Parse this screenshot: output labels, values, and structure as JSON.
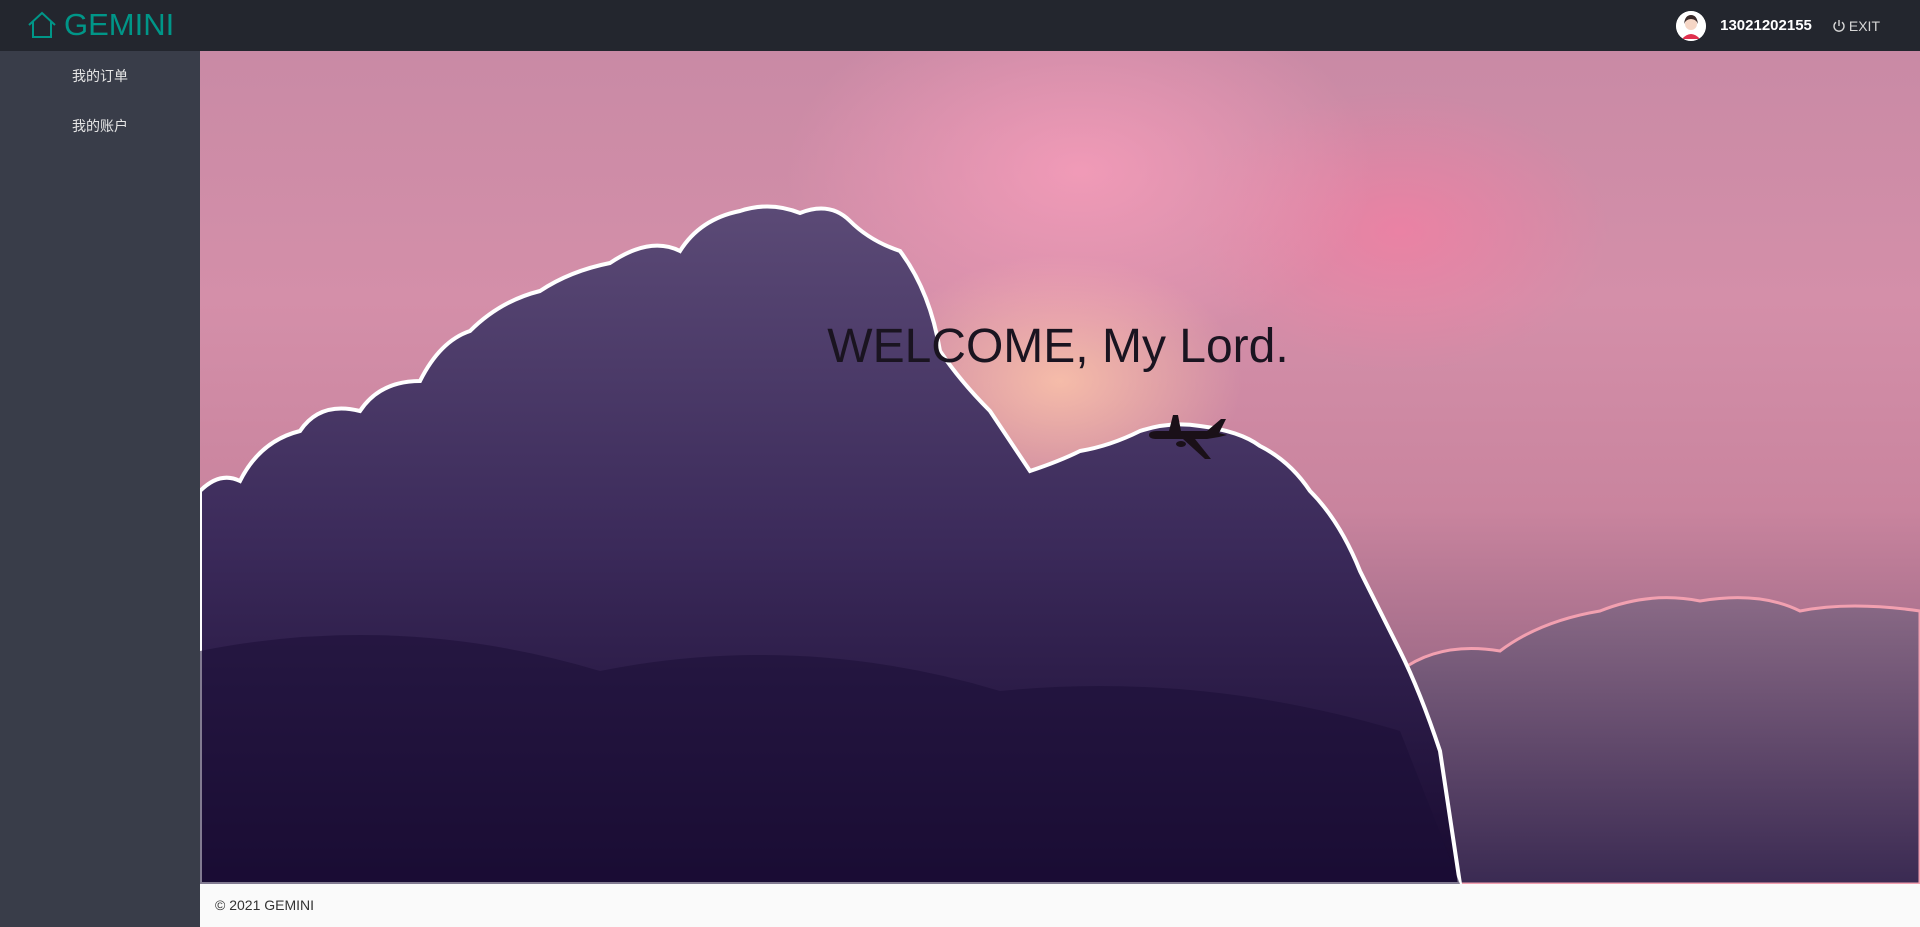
{
  "header": {
    "brand": "GEMINI",
    "username": "13021202155",
    "exit_label": "EXIT"
  },
  "sidebar": {
    "items": [
      {
        "label": "我的订单"
      },
      {
        "label": "我的账户"
      }
    ]
  },
  "main": {
    "welcome": "WELCOME, My Lord."
  },
  "footer": {
    "text": "© 2021 GEMINI"
  },
  "colors": {
    "topbar": "#23262e",
    "sidebar": "#393d49",
    "brand": "#009688",
    "footer_bg": "#fafafa"
  },
  "icons": {
    "brand": "home-icon",
    "exit": "power-icon",
    "avatar": "user-avatar"
  }
}
